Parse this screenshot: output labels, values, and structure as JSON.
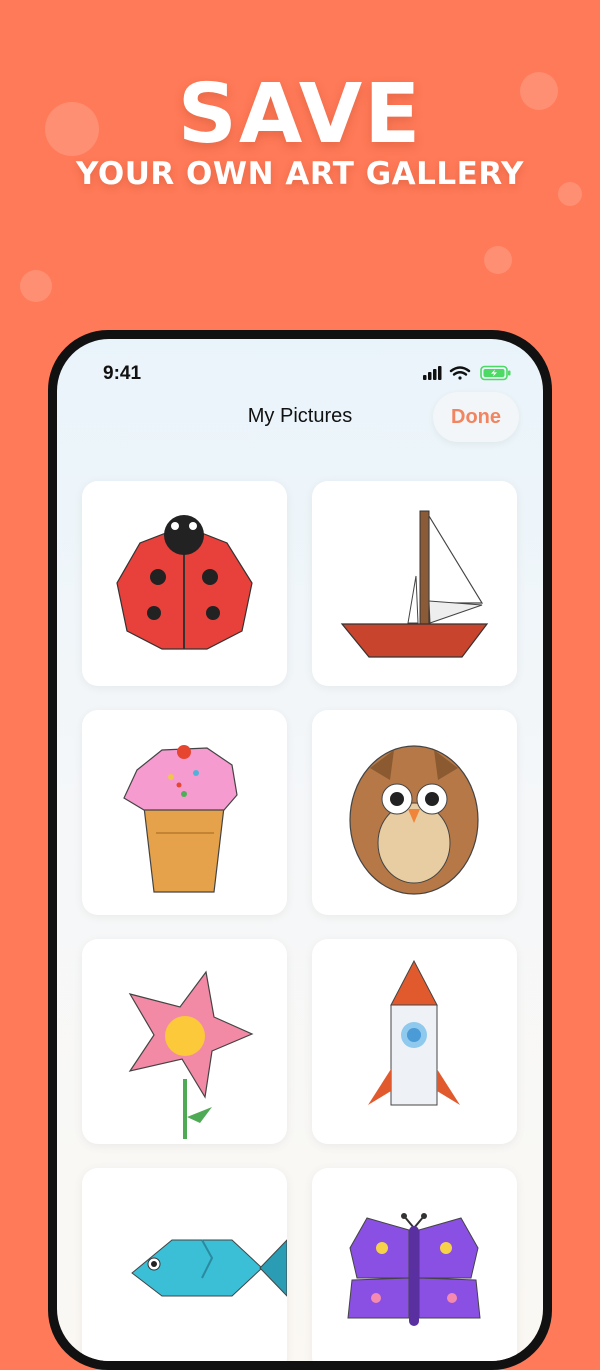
{
  "promo": {
    "headline": "SAVE",
    "subheadline": "YOUR OWN ART GALLERY"
  },
  "status_bar": {
    "time": "9:41"
  },
  "nav": {
    "title": "My Pictures",
    "done_label": "Done"
  },
  "pictures": [
    {
      "name": "ladybug",
      "icon": "ladybug-drawing"
    },
    {
      "name": "sailboat",
      "icon": "sailboat-drawing"
    },
    {
      "name": "ice cream",
      "icon": "ice-cream-drawing"
    },
    {
      "name": "owl",
      "icon": "owl-drawing"
    },
    {
      "name": "flower",
      "icon": "flower-drawing"
    },
    {
      "name": "rocket",
      "icon": "rocket-drawing"
    },
    {
      "name": "fish",
      "icon": "fish-drawing"
    },
    {
      "name": "butterfly",
      "icon": "butterfly-drawing"
    }
  ],
  "colors": {
    "background": "#ff7a58",
    "accent": "#f2845f",
    "battery": "#4cd964"
  }
}
